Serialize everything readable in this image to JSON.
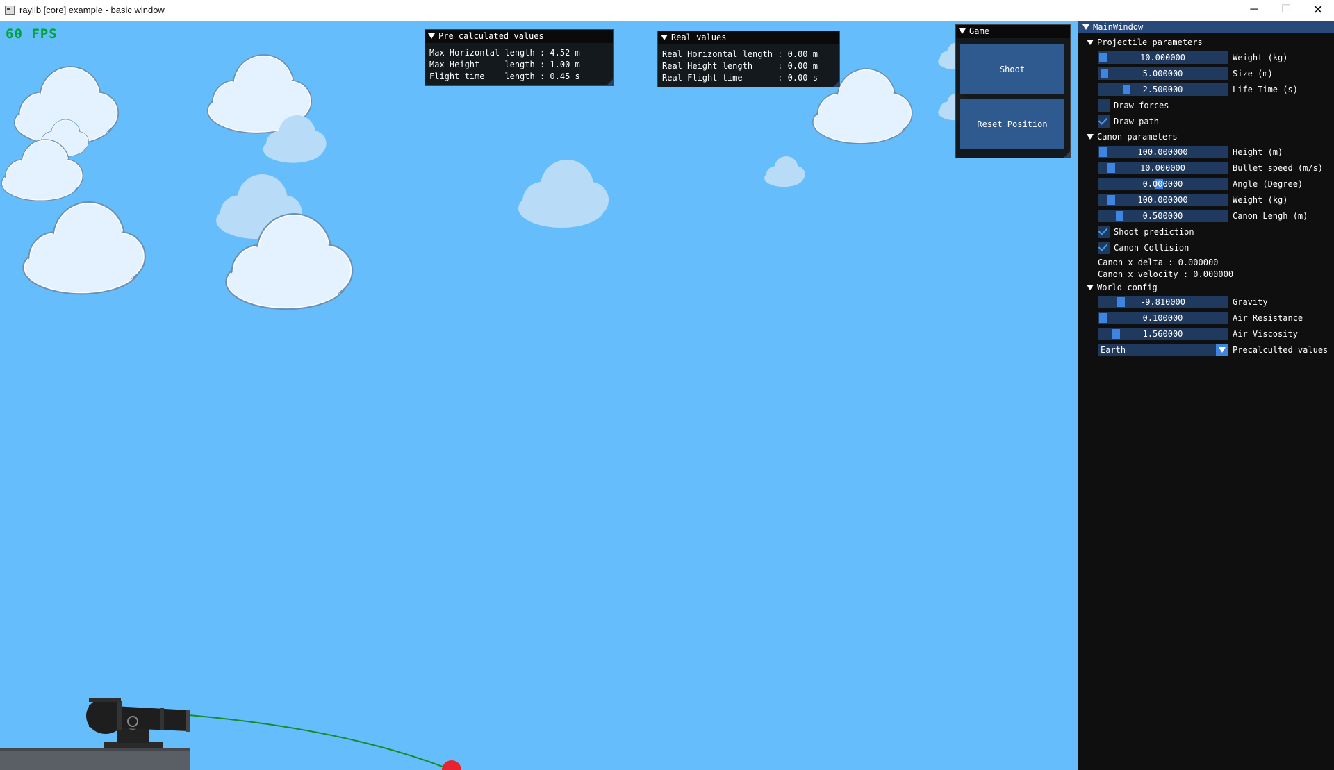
{
  "window": {
    "title": "raylib [core] example - basic window",
    "controls": {
      "minimize": "─",
      "maximize": "☐",
      "close": "✕"
    }
  },
  "hud": {
    "fps": "60 FPS"
  },
  "precalc_window": {
    "title": "Pre calculated values",
    "lines": [
      "Max Horizontal length : 4.52 m",
      "Max Height     length : 1.00 m",
      "Flight time    length : 0.45 s"
    ]
  },
  "real_window": {
    "title": "Real values",
    "lines": [
      "Real Horizontal length : 0.00 m",
      "Real Height length     : 0.00 m",
      "Real Flight time       : 0.00 s"
    ]
  },
  "game_window": {
    "title": "Game",
    "shoot": "Shoot",
    "reset": "Reset Position"
  },
  "main_window": {
    "title": "MainWindow",
    "projectile": {
      "title": "Projectile parameters",
      "sliders": [
        {
          "value": "10.000000",
          "label": "Weight (kg)",
          "fraction": 0.0
        },
        {
          "value": "5.000000",
          "label": "Size (m)",
          "fraction": 0.01
        },
        {
          "value": "2.500000",
          "label": "Life Time (s)",
          "fraction": 0.2
        }
      ],
      "checks": [
        {
          "label": "Draw forces",
          "checked": false
        },
        {
          "label": "Draw path",
          "checked": true
        }
      ]
    },
    "canon": {
      "title": "Canon parameters",
      "sliders": [
        {
          "value": "100.000000",
          "label": "Height (m)",
          "fraction": 0.0
        },
        {
          "value": "10.000000",
          "label": "Bullet speed (m/s)",
          "fraction": 0.07
        },
        {
          "value": "0.000000",
          "label": "Angle (Degree)",
          "fraction": 0.47
        },
        {
          "value": "100.000000",
          "label": "Weight (kg)",
          "fraction": 0.07
        },
        {
          "value": "0.500000",
          "label": "Canon Lengh (m)",
          "fraction": 0.14
        }
      ],
      "checks": [
        {
          "label": "Shoot prediction",
          "checked": true
        },
        {
          "label": "Canon Collision",
          "checked": true
        }
      ],
      "texts": [
        "Canon x delta : 0.000000",
        "Canon x velocity : 0.000000"
      ]
    },
    "world": {
      "title": "World config",
      "sliders": [
        {
          "value": "-9.810000",
          "label": "Gravity",
          "fraction": 0.15
        },
        {
          "value": "0.100000",
          "label": "Air Resistance",
          "fraction": 0.0
        },
        {
          "value": "1.560000",
          "label": "Air Viscosity",
          "fraction": 0.11
        }
      ],
      "combo": {
        "value": "Earth",
        "label": "Precalculted values"
      }
    }
  },
  "colors": {
    "sky": "#65bdfb",
    "cloud": "#e3f2fe",
    "path": "#1a8a2a",
    "projectile": "#e8232f",
    "panel_bg": "#0f0f0f",
    "frame_bg": "#1f3a5e",
    "accent": "#3d85e0"
  }
}
